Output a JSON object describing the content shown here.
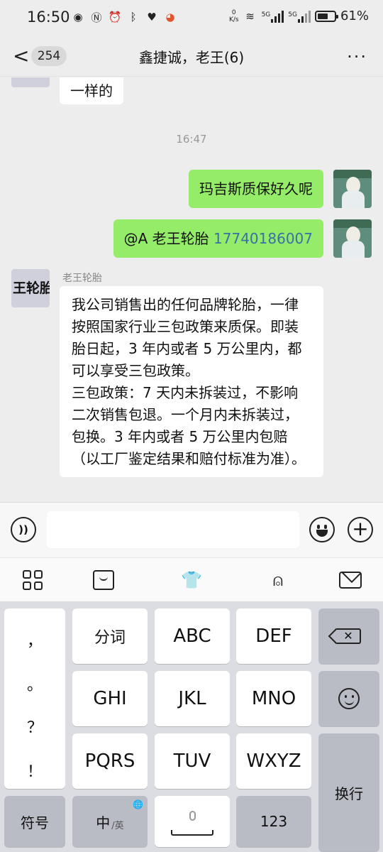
{
  "status_bar": {
    "time": "16:50",
    "net_speed_value": "0",
    "net_speed_unit": "K/s",
    "sig1_label": "5G",
    "sig2_label": "5G",
    "battery": "61%"
  },
  "header": {
    "back_glyph": "<",
    "unread_count": "254",
    "title": "鑫捷诚，老王(6)",
    "more_glyph": "···"
  },
  "chat": {
    "messages": [
      {
        "side": "left",
        "text": "一样的"
      },
      {
        "timestamp": "16:47"
      },
      {
        "side": "right",
        "text": "玛吉斯质保好久呢"
      },
      {
        "side": "right",
        "mention": "@A 老王轮胎 ",
        "link": "17740186007"
      },
      {
        "side": "left",
        "sender": "老王轮胎",
        "avatar_text": "王轮胎",
        "text": "我公司销售出的任何品牌轮胎，一律按照国家行业三包政策来质保。即装胎日起，3 年内或者 5 万公里内，都可以享受三包政策。\n三包政策：7 天内未拆装过，不影响二次销售包退。一个月内未拆装过，包换。3 年内或者 5 万公里内包赔（以工厂鉴定结果和赔付标准为准）。"
      }
    ]
  },
  "input_bar": {
    "voice_icon": "voice-icon",
    "emoji_icon": "emoji-icon",
    "plus_icon": "plus-icon",
    "plus_glyph": "+",
    "voice_glyph": "))",
    "text_value": ""
  },
  "keyboard_toolbar": {
    "icons": [
      "apps-grid-icon",
      "clipboard-icon",
      "skin-icon",
      "ai-assistant-icon",
      "collapse-keyboard-icon"
    ]
  },
  "keyboard": {
    "symbols": [
      "，",
      "。",
      "？",
      "！"
    ],
    "fenci": "分词",
    "abc": "ABC",
    "def": "DEF",
    "ghi": "GHI",
    "jkl": "JKL",
    "mno": "MNO",
    "pqrs": "PQRS",
    "tuv": "TUV",
    "wxyz": "WXYZ",
    "enter": "换行",
    "sym": "符号",
    "lang_main": "中",
    "lang_sub": "/英",
    "num": "123",
    "globe_glyph": "🌐",
    "del_glyph": "✕"
  }
}
